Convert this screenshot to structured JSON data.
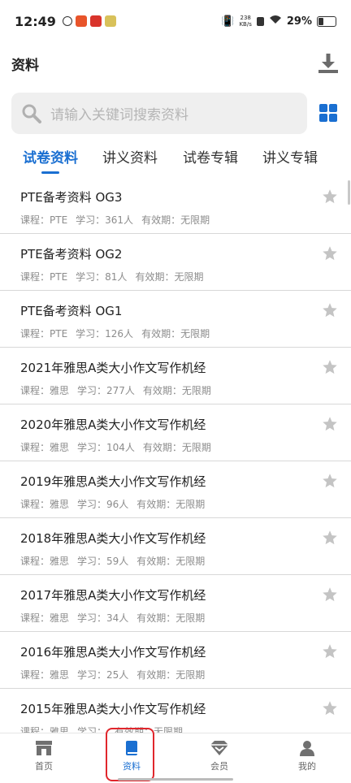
{
  "status": {
    "time": "12:49",
    "net_rate": "238",
    "net_unit": "KB/s",
    "battery": "29%"
  },
  "header": {
    "title": "资料"
  },
  "search": {
    "placeholder": "请输入关键词搜索资料"
  },
  "tabs": [
    {
      "label": "试卷资料",
      "active": true
    },
    {
      "label": "讲义资料"
    },
    {
      "label": "试卷专辑"
    },
    {
      "label": "讲义专辑"
    }
  ],
  "items": [
    {
      "title": "PTE备考资料 OG3",
      "course": "课程：PTE",
      "study": "学习：361人",
      "valid": "有效期：无限期"
    },
    {
      "title": "PTE备考资料 OG2",
      "course": "课程：PTE",
      "study": "学习：81人",
      "valid": "有效期：无限期"
    },
    {
      "title": "PTE备考资料 OG1",
      "course": "课程：PTE",
      "study": "学习：126人",
      "valid": "有效期：无限期"
    },
    {
      "title": "2021年雅思A类大小作文写作机经",
      "course": "课程：雅思",
      "study": "学习：277人",
      "valid": "有效期：无限期"
    },
    {
      "title": "2020年雅思A类大小作文写作机经",
      "course": "课程：雅思",
      "study": "学习：104人",
      "valid": "有效期：无限期"
    },
    {
      "title": "2019年雅思A类大小作文写作机经",
      "course": "课程：雅思",
      "study": "学习：96人",
      "valid": "有效期：无限期"
    },
    {
      "title": "2018年雅思A类大小作文写作机经",
      "course": "课程：雅思",
      "study": "学习：59人",
      "valid": "有效期：无限期"
    },
    {
      "title": "2017年雅思A类大小作文写作机经",
      "course": "课程：雅思",
      "study": "学习：34人",
      "valid": "有效期：无限期"
    },
    {
      "title": "2016年雅思A类大小作文写作机经",
      "course": "课程：雅思",
      "study": "学习：25人",
      "valid": "有效期：无限期"
    },
    {
      "title": "2015年雅思A类大小作文写作机经",
      "course": "课程：雅思",
      "study": "学习：",
      "valid": "有效期：无限期"
    }
  ],
  "nav": [
    {
      "label": "首页"
    },
    {
      "label": "资料",
      "active": true
    },
    {
      "label": "会员"
    },
    {
      "label": "我的"
    }
  ],
  "colors": {
    "accent": "#1a6fd1",
    "highlight": "#e0262c"
  }
}
